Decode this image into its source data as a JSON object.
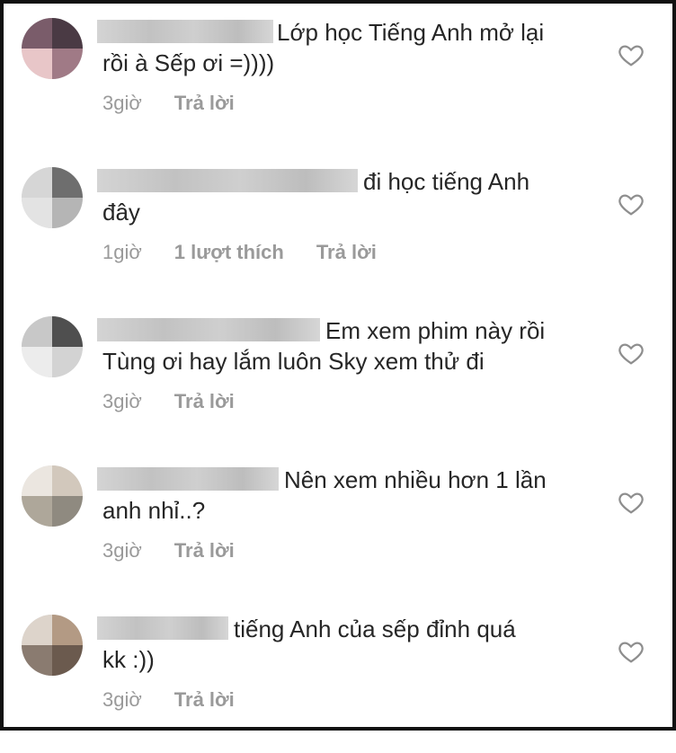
{
  "comments": [
    {
      "text_line1": "Lớp học Tiếng Anh mở lại",
      "text_line2": "rồi à Sếp ơi =))))",
      "time": "3giờ",
      "likes": "",
      "reply": "Trả lời",
      "icon": "heart-icon"
    },
    {
      "text_line1": "đi học tiếng Anh",
      "text_line2": "đây",
      "time": "1giờ",
      "likes": "1 lượt thích",
      "reply": "Trả lời",
      "icon": "heart-icon"
    },
    {
      "text_line1": "Em xem phim này rồi",
      "text_line2": "Tùng ơi hay lắm luôn Sky xem thử đi",
      "time": "3giờ",
      "likes": "",
      "reply": "Trả lời",
      "icon": "heart-icon"
    },
    {
      "text_line1": "Nên xem nhiều hơn 1 lần",
      "text_line2": "anh nhỉ..?",
      "time": "3giờ",
      "likes": "",
      "reply": "Trả lời",
      "icon": "heart-icon"
    },
    {
      "text_line1": "tiếng Anh của sếp đỉnh quá",
      "text_line2": "kk :))",
      "time": "3giờ",
      "likes": "",
      "reply": "Trả lời",
      "icon": "heart-icon"
    }
  ],
  "colors": {
    "text": "#262626",
    "meta": "#9a9a9a",
    "border": "#111111"
  }
}
